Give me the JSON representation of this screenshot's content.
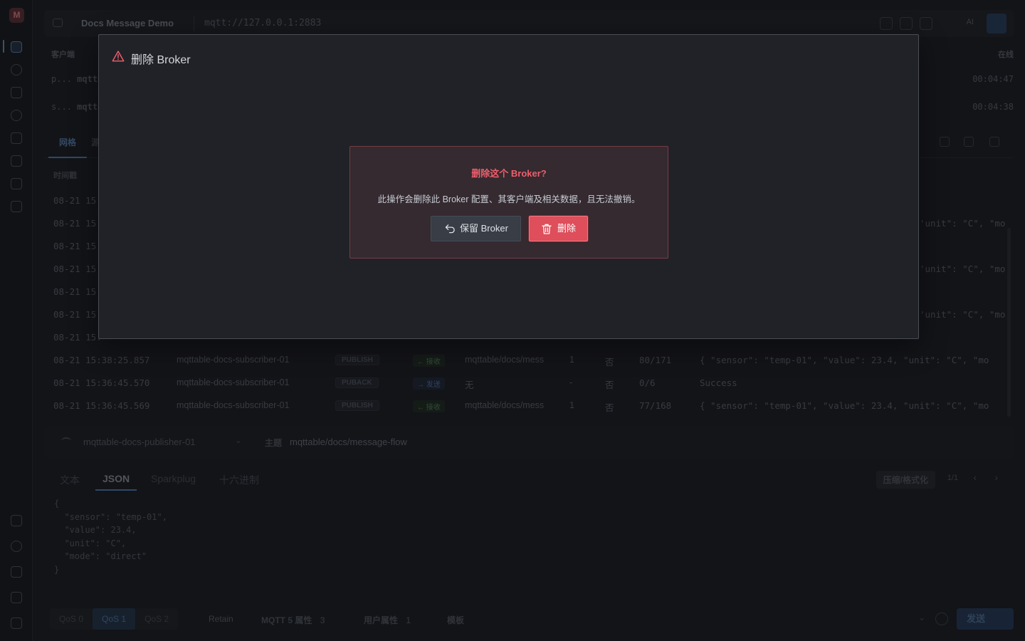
{
  "window": {
    "connection_name": "Docs Message Demo",
    "broker_url": "mqtt://127.0.0.1:2883",
    "ai_label": "AI"
  },
  "clients": {
    "header_left": "客户端",
    "header_right": "在线",
    "rows": [
      {
        "prefix": "p...",
        "name": "mqtta",
        "time": "00:04:47"
      },
      {
        "prefix": "s...",
        "name": "mqtta",
        "time": "00:04:38"
      }
    ]
  },
  "messages": {
    "view_tabs": [
      "网格",
      "源"
    ],
    "timestamp_header": "时间戳",
    "hidden_rows": [
      {
        "time": "08-21 15:",
        "payload": ""
      },
      {
        "time": "08-21 15:",
        "payload": "'unit\": \"C\", \"mo"
      },
      {
        "time": "08-21 15:",
        "payload": ""
      },
      {
        "time": "08-21 15:",
        "payload": "'unit\": \"C\", \"mo"
      },
      {
        "time": "08-21 15:",
        "payload": ""
      },
      {
        "time": "08-21 15:",
        "payload": "'unit\": \"C\", \"mo"
      },
      {
        "time": "08-21 15:",
        "payload": ""
      }
    ],
    "rows": [
      {
        "time": "08-21 15:38:25.857",
        "client": "mqttable-docs-subscriber-01",
        "type": "PUBLISH",
        "direction": "← 接收",
        "dir_kind": "in",
        "topic": "mqttable/docs/mess",
        "qos": "1",
        "retain": "否",
        "size": "80/171",
        "payload": "{ \"sensor\": \"temp-01\", \"value\": 23.4, \"unit\": \"C\", \"mo"
      },
      {
        "time": "08-21 15:36:45.570",
        "client": "mqttable-docs-subscriber-01",
        "type": "PUBACK",
        "direction": "→ 发送",
        "dir_kind": "out",
        "topic": "无",
        "qos": "-",
        "retain": "否",
        "size": "0/6",
        "payload": "Success"
      },
      {
        "time": "08-21 15:36:45.569",
        "client": "mqttable-docs-subscriber-01",
        "type": "PUBLISH",
        "direction": "← 接收",
        "dir_kind": "in",
        "topic": "mqttable/docs/mess",
        "qos": "1",
        "retain": "否",
        "size": "77/168",
        "payload": "{ \"sensor\": \"temp-01\", \"value\": 23.4, \"unit\": \"C\", \"mo"
      }
    ]
  },
  "composer": {
    "client": "mqttable-docs-publisher-01",
    "topic_label": "主题",
    "topic": "mqttable/docs/message-flow",
    "format_tabs": [
      "文本",
      "JSON",
      "Sparkplug",
      "十六进制"
    ],
    "format_button": "压缩/格式化",
    "pager": "1/1",
    "payload": "{\n  \"sensor\": \"temp-01\",\n  \"value\": 23.4,\n  \"unit\": \"C\",\n  \"mode\": \"direct\"\n}",
    "qos_options": [
      "QoS 0",
      "QoS 1",
      "QoS 2"
    ],
    "retain_label": "Retain",
    "mqtt5_label": "MQTT 5 属性",
    "mqtt5_count": "3",
    "user_props_label": "用户属性",
    "user_props_count": "1",
    "template_label": "模板",
    "send_label": "发送"
  },
  "modal": {
    "title": "删除 Broker",
    "question": "删除这个 Broker?",
    "description": "此操作会删除此 Broker 配置、其客户端及相关数据，且无法撤销。",
    "keep_label": "保留 Broker",
    "delete_label": "删除"
  },
  "colors": {
    "danger": "#de4e5b",
    "danger_text": "#ef5f6c",
    "accent": "#4c7db2"
  }
}
